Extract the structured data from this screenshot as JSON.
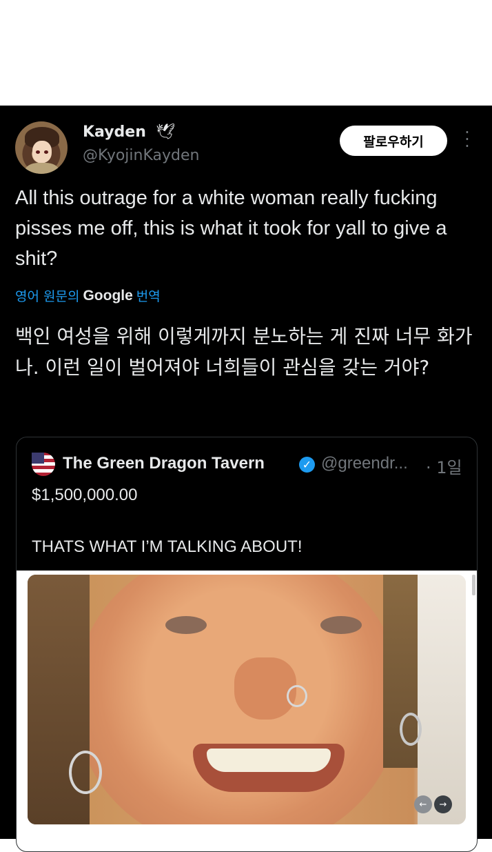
{
  "author": {
    "name": "Kayden",
    "name_icon": "dove-icon",
    "handle": "@KyojinKayden"
  },
  "follow_label": "팔로우하기",
  "more_icon": "more-vertical-icon",
  "tweet_text": "All this outrage for a white woman really fucking pisses me off, this is what it took for yall to give a shit?",
  "translate": {
    "prefix": "영어 원문의",
    "provider": "Google",
    "suffix": "번역"
  },
  "translated_text": "백인 여성을 위해 이렇게까지 분노하는 게 진짜 너무 화가 나. 이런 일이 벌어져야 너희들이 관심을 갖는 거야?",
  "quote": {
    "name": "The Green Dragon Tavern",
    "verified_icon": "verified-badge-icon",
    "handle": "@greendr...",
    "time": "· 1일",
    "line1": "$1,500,000.00",
    "line2": "THATS WHAT I’M TALKING ABOUT!"
  },
  "colors": {
    "background": "#000000",
    "text": "#e7e9ea",
    "secondary": "#71767b",
    "link": "#1d9bf0"
  }
}
